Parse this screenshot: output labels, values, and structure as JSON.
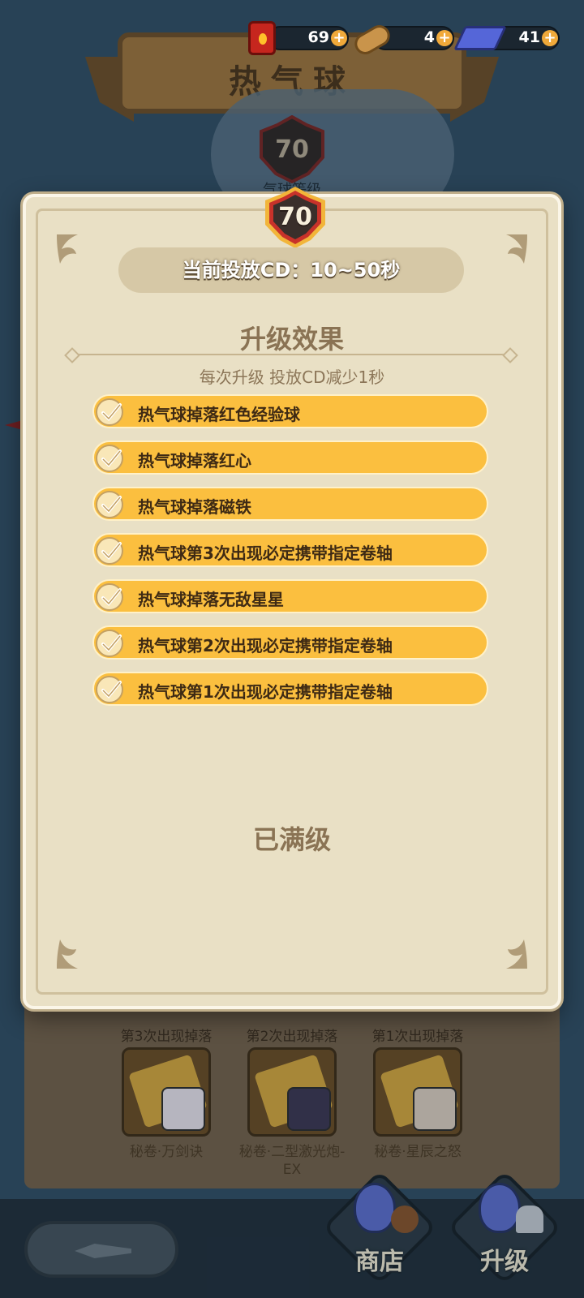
{
  "resources": [
    {
      "icon": "fuel-barrel-icon",
      "value": "69"
    },
    {
      "icon": "wood-log-icon",
      "value": "4"
    },
    {
      "icon": "cloth-icon",
      "value": "41"
    }
  ],
  "background": {
    "title": "热气球",
    "level": "70",
    "level_caption": "气球等级",
    "drops": [
      {
        "caption": "第3次出现掉落",
        "name": "秘卷·万剑诀"
      },
      {
        "caption": "第2次出现掉落",
        "name": "秘卷·二型激光炮-EX"
      },
      {
        "caption": "第1次出现掉落",
        "name": "秘卷·星辰之怒"
      }
    ]
  },
  "modal": {
    "level": "70",
    "cd_text": "当前投放CD：10~50秒",
    "effect_title": "升级效果",
    "effect_desc": "每次升级 投放CD减少1秒",
    "effects": [
      "热气球掉落红色经验球",
      "热气球掉落红心",
      "热气球掉落磁铁",
      "热气球第3次出现必定携带指定卷轴",
      "热气球掉落无敌星星",
      "热气球第2次出现必定携带指定卷轴",
      "热气球第1次出现必定携带指定卷轴"
    ],
    "maxed_text": "已满级"
  },
  "nav": {
    "shop": "商店",
    "upgrade": "升级"
  },
  "colors": {
    "accent": "#fbbf3f",
    "panel": "#e9e0c5",
    "text_brown": "#8a7354"
  }
}
